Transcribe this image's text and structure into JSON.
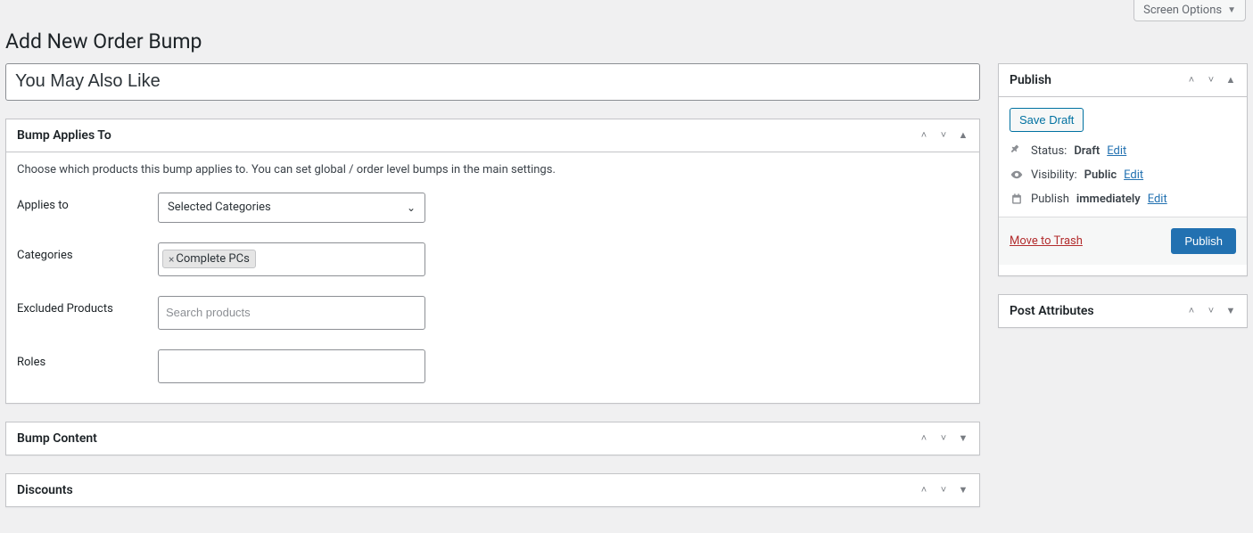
{
  "screenOptions": "Screen Options",
  "pageTitle": "Add New Order Bump",
  "titleInputValue": "You May Also Like",
  "box_bump_applies": {
    "title": "Bump Applies To",
    "desc": "Choose which products this bump applies to. You can set global / order level bumps in the main settings.",
    "labels": {
      "appliesTo": "Applies to",
      "categories": "Categories",
      "excluded": "Excluded Products",
      "roles": "Roles"
    },
    "appliesToValue": "Selected Categories",
    "categoryTag": "Complete PCs",
    "excludedPlaceholder": "Search products"
  },
  "box_bump_content": {
    "title": "Bump Content"
  },
  "box_discounts": {
    "title": "Discounts"
  },
  "publish": {
    "title": "Publish",
    "saveDraft": "Save Draft",
    "statusLabel": "Status:",
    "statusValue": "Draft",
    "visibilityLabel": "Visibility:",
    "visibilityValue": "Public",
    "publishLabel": "Publish",
    "publishValue": "immediately",
    "edit": "Edit",
    "trash": "Move to Trash",
    "publishBtn": "Publish"
  },
  "postAttributes": {
    "title": "Post Attributes"
  }
}
